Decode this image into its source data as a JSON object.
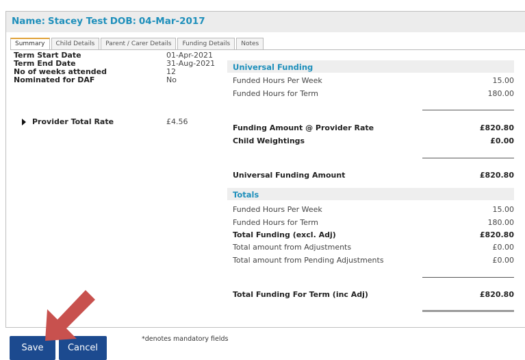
{
  "header": {
    "name_label": "Name:",
    "name_value": "Stacey Test",
    "dob_label": "DOB:",
    "dob_value": "04-Mar-2017"
  },
  "tabs": [
    {
      "label": "Summary",
      "active": true
    },
    {
      "label": "Child Details",
      "active": false
    },
    {
      "label": "Parent / Carer Details",
      "active": false
    },
    {
      "label": "Funding Details",
      "active": false
    },
    {
      "label": "Notes",
      "active": false
    }
  ],
  "summary": {
    "term_start_label": "Term Start Date",
    "term_start_value": "01-Apr-2021",
    "term_end_label": "Term End Date",
    "term_end_value": "31-Aug-2021",
    "weeks_label": "No of weeks attended",
    "weeks_value": "12",
    "daf_label": "Nominated for DAF",
    "daf_value": "No",
    "provider_rate_label": "Provider Total Rate",
    "provider_rate_value": "£4.56"
  },
  "universal": {
    "heading": "Universal Funding",
    "hours_week_label": "Funded Hours Per Week",
    "hours_week_value": "15.00",
    "hours_term_label": "Funded Hours for Term",
    "hours_term_value": "180.00",
    "funding_amount_label": "Funding Amount @ Provider Rate",
    "funding_amount_value": "£820.80",
    "weightings_label": "Child Weightings",
    "weightings_value": "£0.00",
    "universal_amount_label": "Universal Funding Amount",
    "universal_amount_value": "£820.80"
  },
  "totals": {
    "heading": "Totals",
    "hours_week_label": "Funded Hours Per Week",
    "hours_week_value": "15.00",
    "hours_term_label": "Funded Hours for Term",
    "hours_term_value": "180.00",
    "total_excl_label": "Total Funding (excl. Adj)",
    "total_excl_value": "£820.80",
    "adjustments_label": "Total amount from Adjustments",
    "adjustments_value": "£0.00",
    "pending_label": "Total amount from Pending Adjustments",
    "pending_value": "£0.00",
    "total_inc_label": "Total Funding For Term (inc Adj)",
    "total_inc_value": "£820.80"
  },
  "footer": {
    "save_label": "Save",
    "cancel_label": "Cancel",
    "mandatory_note": "*denotes mandatory fields"
  },
  "colors": {
    "accent": "#1e8fbb",
    "button": "#1c4a8f",
    "arrow": "#c8514e",
    "active_tab": "#e0a23a"
  }
}
